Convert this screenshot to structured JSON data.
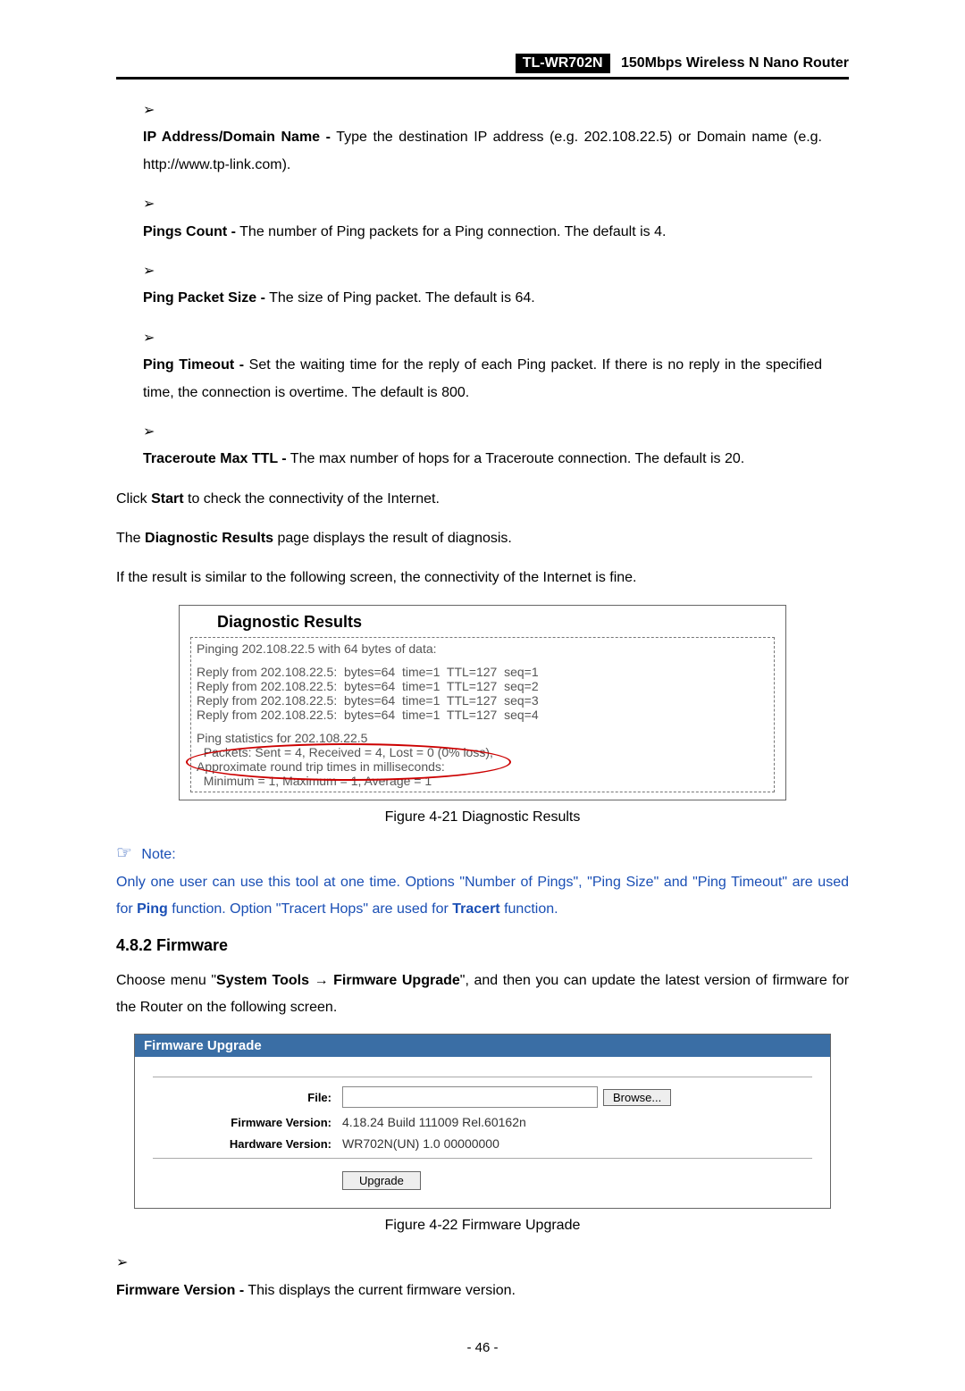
{
  "header": {
    "model": "TL-WR702N",
    "description": "150Mbps  Wireless  N  Nano  Router"
  },
  "bullets": [
    {
      "label": "IP Address/Domain Name -",
      "text": " Type the destination IP address (e.g. 202.108.22.5) or Domain name (e.g. http://www.tp-link.com)."
    },
    {
      "label": "Pings Count -",
      "text": " The number of Ping packets for a Ping connection. The default is 4."
    },
    {
      "label": "Ping Packet Size -",
      "text": " The size of Ping packet. The default is 64."
    },
    {
      "label": "Ping Timeout -",
      "text": " Set the waiting time for the reply of each Ping packet. If there is no reply in the specified time, the connection is overtime. The default is 800."
    },
    {
      "label": "Traceroute Max TTL -",
      "text": " The max number of hops for a Traceroute connection. The default is 20."
    }
  ],
  "click_start_pre": "Click ",
  "click_start_bold": "Start",
  "click_start_post": " to check the connectivity of the Internet.",
  "diag_results_pre": "The ",
  "diag_results_bold": "Diagnostic Results",
  "diag_results_post": " page displays the result of diagnosis.",
  "if_result": "If the result is similar to the following screen, the connectivity of the Internet is fine.",
  "diag": {
    "title": "Diagnostic Results",
    "lines": [
      "Pinging 202.108.22.5 with 64 bytes of data:",
      "",
      "Reply from 202.108.22.5:  bytes=64  time=1  TTL=127  seq=1",
      "Reply from 202.108.22.5:  bytes=64  time=1  TTL=127  seq=2",
      "Reply from 202.108.22.5:  bytes=64  time=1  TTL=127  seq=3",
      "Reply from 202.108.22.5:  bytes=64  time=1  TTL=127  seq=4",
      "",
      "Ping statistics for 202.108.22.5",
      "  Packets: Sent = 4, Received = 4, Lost = 0 (0% loss),",
      "Approximate round trip times in milliseconds:",
      "  Minimum = 1, Maximum = 1, Average = 1"
    ]
  },
  "figure1": "Figure 4-21    Diagnostic Results",
  "note_label": "Note:",
  "note_body_1": "Only one user can use this tool at one time. Options \"Number of Pings\", \"Ping Size\" and \"Ping Timeout\" are used for ",
  "note_bold_1": "Ping",
  "note_body_2": " function. Option \"Tracert Hops\" are used for ",
  "note_bold_2": "Tracert",
  "note_body_3": " function.",
  "section": "4.8.2   Firmware",
  "fw_para_1": "Choose menu \"",
  "fw_bold_1": "System Tools",
  "fw_arrow": " → ",
  "fw_bold_2": "Firmware Upgrade",
  "fw_para_2": "\", and then you can update the latest version of firmware for the Router on the following screen.",
  "fw": {
    "title": "Firmware Upgrade",
    "file_label": "File:",
    "file_value": "",
    "browse": "Browse...",
    "fwver_label": "Firmware Version:",
    "fwver_value": "4.18.24 Build 111009 Rel.60162n",
    "hwver_label": "Hardware Version:",
    "hwver_value": "WR702N(UN) 1.0 00000000",
    "upgrade": "Upgrade"
  },
  "figure2": "Figure 4-22    Firmware Upgrade",
  "bullet2": {
    "label": "Firmware Version -",
    "text": " This displays the current firmware version."
  },
  "page_number": "- 46 -"
}
